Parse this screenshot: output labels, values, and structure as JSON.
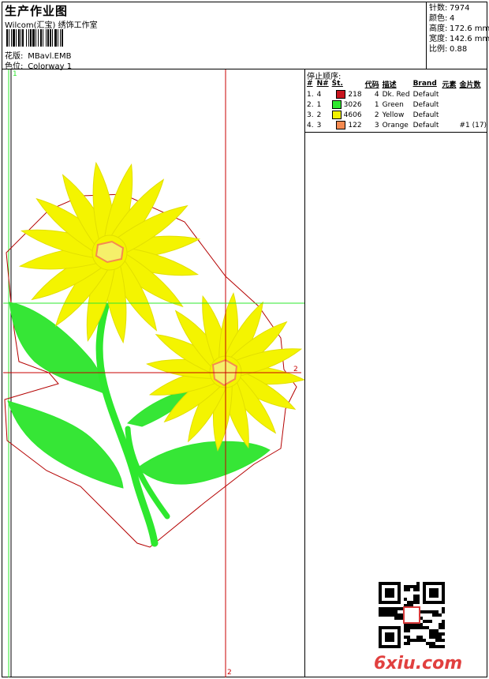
{
  "header": {
    "title": "生产作业图",
    "subtitle": "Wilcom(汇宝) 绣饰工作室",
    "design_label": "花版:",
    "design_value": "MBavl.EMB",
    "colorway_label": "色位:",
    "colorway_value": "Colorway 1"
  },
  "stats": [
    {
      "label": "针数:",
      "value": "7974"
    },
    {
      "label": "颜色:",
      "value": "4"
    },
    {
      "label": "高度:",
      "value": "172.6 mm"
    },
    {
      "label": "宽度:",
      "value": "142.6 mm"
    },
    {
      "label": "比例:",
      "value": "0.88"
    }
  ],
  "stop_sequence": {
    "title": "停止顺序:",
    "headers": [
      "#",
      "N#",
      "St.",
      "代码",
      "描述",
      "Brand",
      "元素",
      "金片数"
    ],
    "rows": [
      {
        "idx": "1.",
        "needle": "4",
        "color": "#c8141e",
        "stitches": "218",
        "code": "4",
        "desc": "Dk. Red",
        "brand": "Default",
        "elem": "",
        "seq": ""
      },
      {
        "idx": "2.",
        "needle": "1",
        "color": "#2ee82e",
        "stitches": "3026",
        "code": "1",
        "desc": "Green",
        "brand": "Default",
        "elem": "",
        "seq": ""
      },
      {
        "idx": "3.",
        "needle": "2",
        "color": "#f2f200",
        "stitches": "4606",
        "code": "2",
        "desc": "Yellow",
        "brand": "Default",
        "elem": "",
        "seq": ""
      },
      {
        "idx": "4.",
        "needle": "3",
        "color": "#f58a50",
        "stitches": "122",
        "code": "3",
        "desc": "Orange",
        "brand": "Default",
        "elem": "",
        "seq": "#1 (17)"
      }
    ]
  },
  "axis_labels": {
    "top": "1",
    "right": "2",
    "bottom": "2"
  },
  "colors": {
    "frame": "#000000",
    "guide_red": "#c80000",
    "guide_green": "#2ee82e",
    "outline": "#b40000"
  },
  "watermark": "6xiu.com"
}
